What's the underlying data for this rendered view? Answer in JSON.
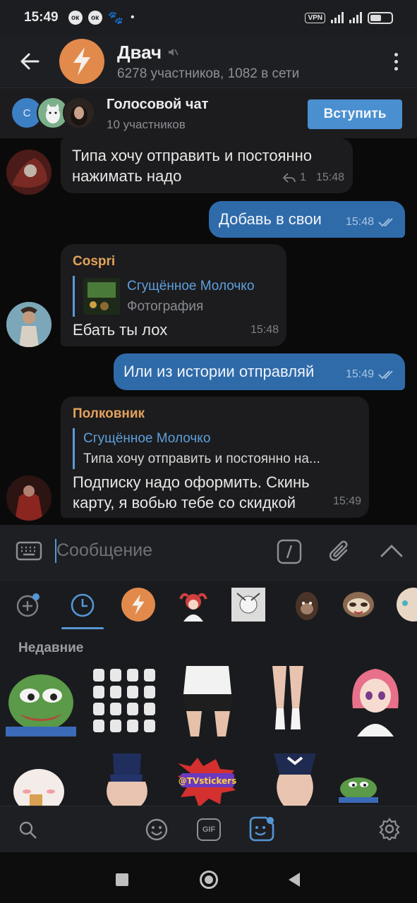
{
  "status_bar": {
    "time": "15:49",
    "icons": [
      "notification-ok-icon",
      "notification-ok-icon",
      "paw-icon",
      "dot-icon"
    ],
    "vpn": "VPN",
    "right_icons": [
      "vpn-icon",
      "signal-h-plus-icon",
      "signal-icon",
      "battery-icon"
    ]
  },
  "header": {
    "title": "Двач",
    "muted_icon": "mute-icon",
    "subtitle": "6278 участников, 1082 в сети",
    "avatar_icon": "lightning-icon",
    "avatar_color": "#e28a4b"
  },
  "voice_chat": {
    "avatar_letter": "С",
    "title": "Голосовой чат",
    "subtitle": "10 участников",
    "join_label": "Вступить",
    "accent": "#4a90d0"
  },
  "messages": [
    {
      "direction": "in",
      "text": "Типа хочу отправить и постоянно нажимать надо",
      "replies_count": "1",
      "time": "15:48"
    },
    {
      "direction": "out",
      "text": "Добавь в свои",
      "time": "15:48"
    },
    {
      "direction": "in",
      "sender": "Cospri",
      "reply_name": "Сгущённое Молочко",
      "reply_text": "Фотография",
      "text": "Ебать ты лох",
      "time": "15:48"
    },
    {
      "direction": "out",
      "text": "Или из истории отправляй",
      "time": "15:49"
    },
    {
      "direction": "in",
      "sender": "Полковник",
      "reply_name": "Сгущённое Молочко",
      "reply_text": "Типа хочу отправить и постоянно на...",
      "text": "Подписку надо оформить. Скинь карту, я вобью тебе со скидкой",
      "time": "15:49"
    }
  ],
  "input": {
    "placeholder": "Сообщение",
    "icons": [
      "keyboard-icon",
      "slash-command-icon",
      "attach-icon",
      "chevron-up-icon"
    ]
  },
  "sticker_tabs": [
    "add-sticker-icon",
    "recent-clock-icon",
    "dvach-pack-icon",
    "anime-pack-icon",
    "manga-pack-icon",
    "monkey-pack-icon",
    "sloth-pack-icon",
    "cat-pack-icon"
  ],
  "stickers": {
    "section_title": "Недавние",
    "items": [
      "pepe-sticker",
      "cats-grid-sticker",
      "shorts-sticker",
      "legs-sticker",
      "anime-girl-sticker",
      "cat-blush-sticker",
      "swimsuit-sticker",
      "tvstickers-sticker",
      "maid-sticker",
      "pepe-small-sticker"
    ]
  },
  "bottom_bar": [
    "search-icon",
    "emoji-icon",
    "gif-icon",
    "sticker-icon",
    "settings-icon"
  ],
  "gif_label": "GIF",
  "nav_bar": [
    "square-nav-icon",
    "home-nav-icon",
    "back-nav-icon"
  ]
}
